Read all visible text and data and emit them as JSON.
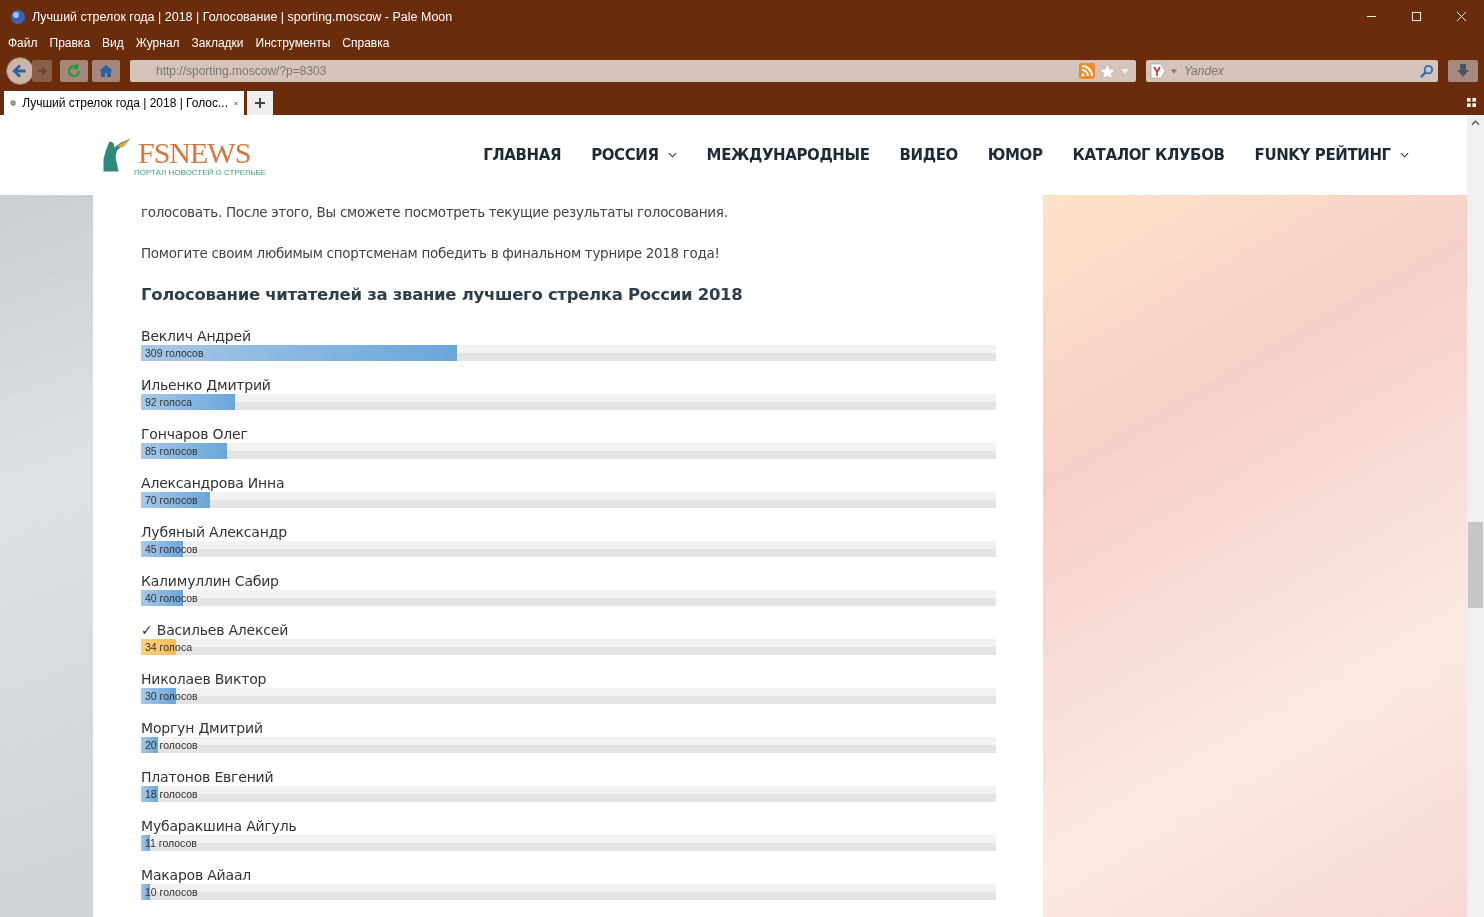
{
  "window": {
    "title": "Лучший стрелок года | 2018 | Голосование | sporting.moscow - Pale Moon"
  },
  "menu": [
    "Файл",
    "Правка",
    "Вид",
    "Журнал",
    "Закладки",
    "Инструменты",
    "Справка"
  ],
  "address_bar": {
    "value": "http://sporting.moscow/?p=8303"
  },
  "search": {
    "placeholder": "Yandex"
  },
  "tabs": [
    {
      "label": "Лучший стрелок года | 2018 | Голос...",
      "selected": true
    }
  ],
  "site": {
    "logo": {
      "title": "FSNEWS",
      "tagline": "ПОРТАЛ НОВОСТЕЙ О СТРЕЛЬБЕ"
    },
    "nav": [
      {
        "label": "ГЛАВНАЯ",
        "dropdown": false
      },
      {
        "label": "РОССИЯ",
        "dropdown": true
      },
      {
        "label": "МЕЖДУНАРОДНЫЕ",
        "dropdown": false
      },
      {
        "label": "ВИДЕО",
        "dropdown": false
      },
      {
        "label": "ЮМОР",
        "dropdown": false
      },
      {
        "label": "КАТАЛОГ КЛУБОВ",
        "dropdown": false
      },
      {
        "label": "FUNKY РЕЙТИНГ",
        "dropdown": true
      }
    ]
  },
  "article": {
    "paragraphs": [
      "голосовать. После этого, Вы сможете посмотреть текущие результаты голосования.",
      "Помогите своим любимым спортсменам победить в финальном турнире 2018 года!"
    ],
    "poll_title": "Голосование читателей за звание лучшего стрелка России 2018",
    "candidates": [
      {
        "name": "Веклич Андрей",
        "votes": "309 голосов",
        "level": 0.37,
        "voted": false
      },
      {
        "name": "Ильенко Дмитрий",
        "votes": "92 голоса",
        "level": 0.11,
        "voted": false
      },
      {
        "name": "Гончаров Олег",
        "votes": "85 голосов",
        "level": 0.1,
        "voted": false
      },
      {
        "name": "Александрова Инна",
        "votes": "70 голосов",
        "level": 0.081,
        "voted": false
      },
      {
        "name": "Лубяный Александр",
        "votes": "45 голосов",
        "level": 0.049,
        "voted": false
      },
      {
        "name": "Калимуллин Сабир",
        "votes": "40 голосов",
        "level": 0.049,
        "voted": false
      },
      {
        "name": "✓ Васильев Алексей",
        "votes": "34 голоса",
        "level": 0.041,
        "voted": true
      },
      {
        "name": "Николаев Виктор",
        "votes": "30 голосов",
        "level": 0.041,
        "voted": false
      },
      {
        "name": "Моргун Дмитрий",
        "votes": "20 голосов",
        "level": 0.02,
        "voted": false
      },
      {
        "name": "Платонов Евгений",
        "votes": "18 голосов",
        "level": 0.02,
        "voted": false
      },
      {
        "name": "Мубаракшина Айгуль",
        "votes": "11 голосов",
        "level": 0.01,
        "voted": false
      },
      {
        "name": "Макаров Айаал",
        "votes": "10 голосов",
        "level": 0.01,
        "voted": false
      }
    ]
  }
}
